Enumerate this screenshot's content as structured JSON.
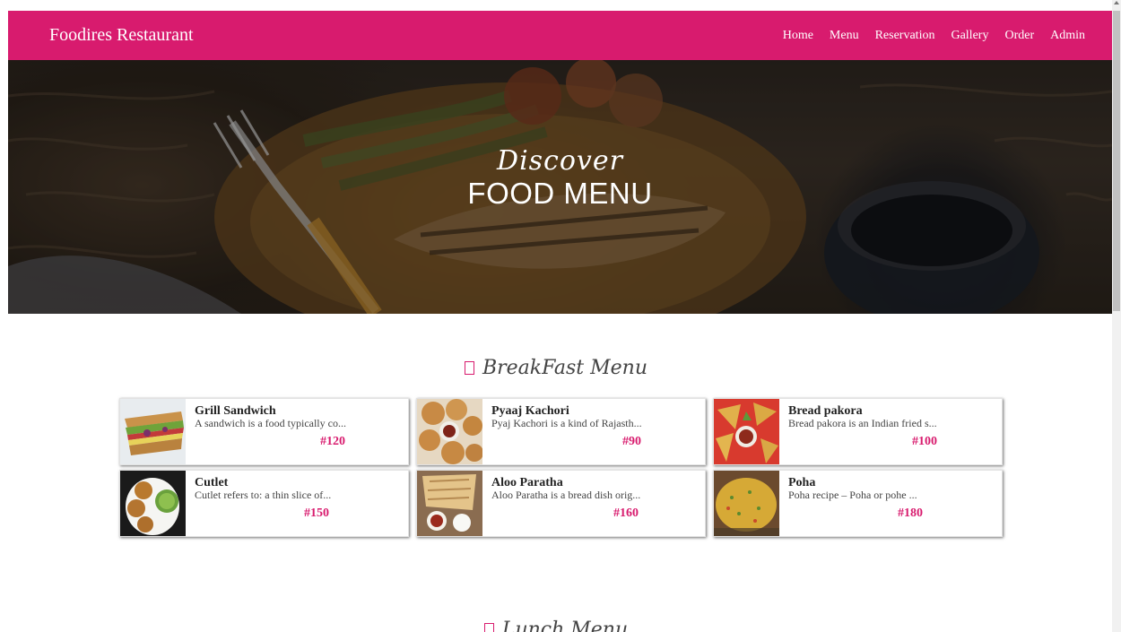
{
  "navbar": {
    "brand": "Foodires Restaurant",
    "links": [
      "Home",
      "Menu",
      "Reservation",
      "Gallery",
      "Order",
      "Admin"
    ]
  },
  "hero": {
    "subtitle": "Discover",
    "title": "FOOD MENU"
  },
  "breakfast": {
    "heading": "BreakFast Menu",
    "items": [
      {
        "name": "Grill Sandwich",
        "desc": "A sandwich is a food typically co...",
        "price": "#120"
      },
      {
        "name": "Pyaaj Kachori",
        "desc": "Pyaj Kachori is a kind of Rajasth...",
        "price": "#90"
      },
      {
        "name": "Bread pakora",
        "desc": "Bread pakora is an Indian fried s...",
        "price": "#100"
      },
      {
        "name": "Cutlet",
        "desc": "Cutlet refers to: a thin slice of...",
        "price": "#150"
      },
      {
        "name": "Aloo Paratha",
        "desc": "Aloo Paratha is a bread dish orig...",
        "price": "#160"
      },
      {
        "name": "Poha",
        "desc": "Poha recipe – Poha or pohe ...",
        "price": "#180"
      }
    ]
  },
  "lunch": {
    "heading": "Lunch Menu"
  },
  "colors": {
    "accent": "#d81b6e",
    "text": "#222222"
  },
  "icons": {
    "section": "menu-square-icon"
  }
}
